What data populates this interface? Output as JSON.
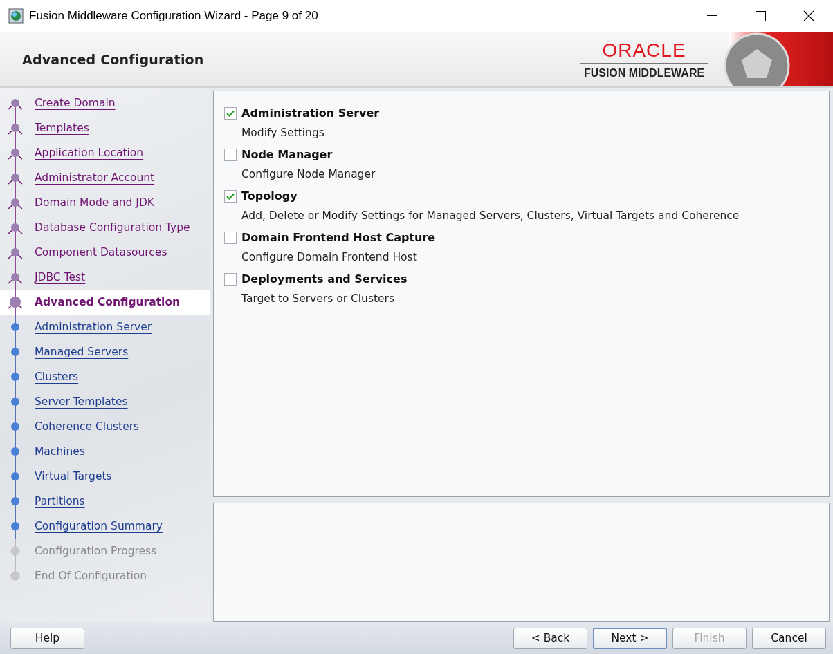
{
  "window": {
    "title": "Fusion Middleware Configuration Wizard - Page 9 of 20"
  },
  "header": {
    "title": "Advanced Configuration",
    "logo_brand": "ORACLE",
    "logo_product": "FUSION MIDDLEWARE"
  },
  "steps": [
    {
      "label": "Create Domain",
      "kind": "visited",
      "selected": false
    },
    {
      "label": "Templates",
      "kind": "visited",
      "selected": false
    },
    {
      "label": "Application Location",
      "kind": "visited",
      "selected": false
    },
    {
      "label": "Administrator Account",
      "kind": "visited",
      "selected": false
    },
    {
      "label": "Domain Mode and JDK",
      "kind": "visited",
      "selected": false
    },
    {
      "label": "Database Configuration Type",
      "kind": "visited",
      "selected": false
    },
    {
      "label": "Component Datasources",
      "kind": "visited",
      "selected": false
    },
    {
      "label": "JDBC Test",
      "kind": "visited",
      "selected": false
    },
    {
      "label": "Advanced Configuration",
      "kind": "current",
      "selected": true
    },
    {
      "label": "Administration Server",
      "kind": "pending",
      "selected": false
    },
    {
      "label": "Managed Servers",
      "kind": "pending",
      "selected": false
    },
    {
      "label": "Clusters",
      "kind": "pending",
      "selected": false
    },
    {
      "label": "Server Templates",
      "kind": "pending",
      "selected": false
    },
    {
      "label": "Coherence Clusters",
      "kind": "pending",
      "selected": false
    },
    {
      "label": "Machines",
      "kind": "pending",
      "selected": false
    },
    {
      "label": "Virtual Targets",
      "kind": "pending",
      "selected": false
    },
    {
      "label": "Partitions",
      "kind": "pending",
      "selected": false
    },
    {
      "label": "Configuration Summary",
      "kind": "pending",
      "selected": false
    },
    {
      "label": "Configuration Progress",
      "kind": "disabled",
      "selected": false
    },
    {
      "label": "End Of Configuration",
      "kind": "disabled",
      "selected": false
    }
  ],
  "options": [
    {
      "label": "Administration Server",
      "description": "Modify Settings",
      "checked": true
    },
    {
      "label": "Node Manager",
      "description": "Configure Node Manager",
      "checked": false
    },
    {
      "label": "Topology",
      "description": "Add, Delete or Modify Settings for Managed Servers, Clusters, Virtual Targets and Coherence",
      "checked": true
    },
    {
      "label": "Domain Frontend Host Capture",
      "description": "Configure Domain Frontend Host",
      "checked": false
    },
    {
      "label": "Deployments and Services",
      "description": "Target to Servers or Clusters",
      "checked": false
    }
  ],
  "buttons": [
    {
      "label": "Help",
      "disabled": false,
      "default": false
    },
    {
      "label": "< Back",
      "disabled": false,
      "default": false
    },
    {
      "label": "Next >",
      "disabled": false,
      "default": true
    },
    {
      "label": "Finish",
      "disabled": true,
      "default": false
    },
    {
      "label": "Cancel",
      "disabled": false,
      "default": false
    }
  ]
}
